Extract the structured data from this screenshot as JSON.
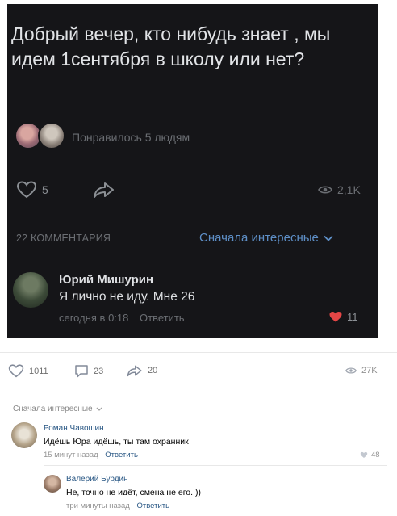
{
  "screenshot": {
    "post_text": "Добрый вечер, кто нибудь знает , мы идем 1сентября в школу или нет?",
    "liked_by": "Понравилось 5 людям",
    "likes": "5",
    "views": "2,1K",
    "comments_count": "22 КОММЕНТАРИЯ",
    "sort_label": "Сначала интересные",
    "comment": {
      "author": "Юрий Мишурин",
      "text": "Я лично не иду. Мне 26",
      "time": "сегодня в 0:18",
      "reply": "Ответить",
      "likes": "11"
    }
  },
  "post_actions": {
    "likes": "1011",
    "comments": "23",
    "shares": "20",
    "views": "27K"
  },
  "comments_section": {
    "sort_label": "Сначала интересные",
    "comments": [
      {
        "author": "Роман Чавошин",
        "text": "Идёшь Юра идёшь, ты там охранник",
        "time": "15 минут назад",
        "reply": "Ответить",
        "likes": "48"
      },
      {
        "author": "Валерий Бурдин",
        "text": "Не, точно не идёт, смена не его. ))",
        "time": "три минуты назад",
        "reply": "Ответить"
      }
    ]
  },
  "colors": {
    "dark_bg": "#151518",
    "link_blue": "#2a5885",
    "heart_red": "#e64646"
  }
}
